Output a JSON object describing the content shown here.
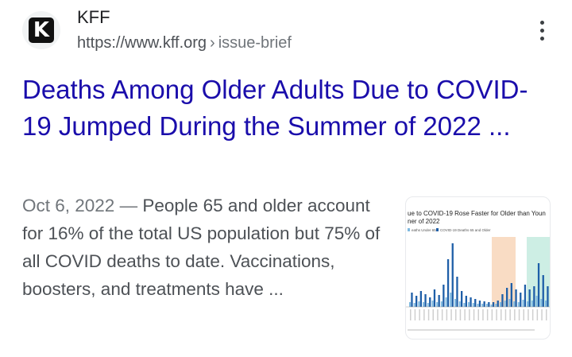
{
  "result": {
    "site_name": "KFF",
    "url_domain": "https://www.kff.org",
    "url_separator": "›",
    "url_path": "issue-brief",
    "favicon_letter": "K",
    "title": "Deaths Among Older Adults Due to COVID-19 Jumped During the Summer of 2022 ...",
    "date": "Oct 6, 2022",
    "date_separator": " — ",
    "snippet": "People 65 and older account for 16% of the total US population but 75% of all COVID deaths to date. Vaccinations, boosters, and treatments have ..."
  },
  "thumbnail": {
    "title_line1": "ue to COVID-19 Rose Faster for Older than Youn",
    "title_line2": "ner of 2022",
    "legend_under": "eaths Under 65",
    "legend_over": "COVID-19 Deaths 65 and Older",
    "colors": {
      "under65": "#7db9e0",
      "over65": "#1f5fa8",
      "orange_band": "#f9dcc4",
      "teal_band": "#cdeee4"
    }
  }
}
